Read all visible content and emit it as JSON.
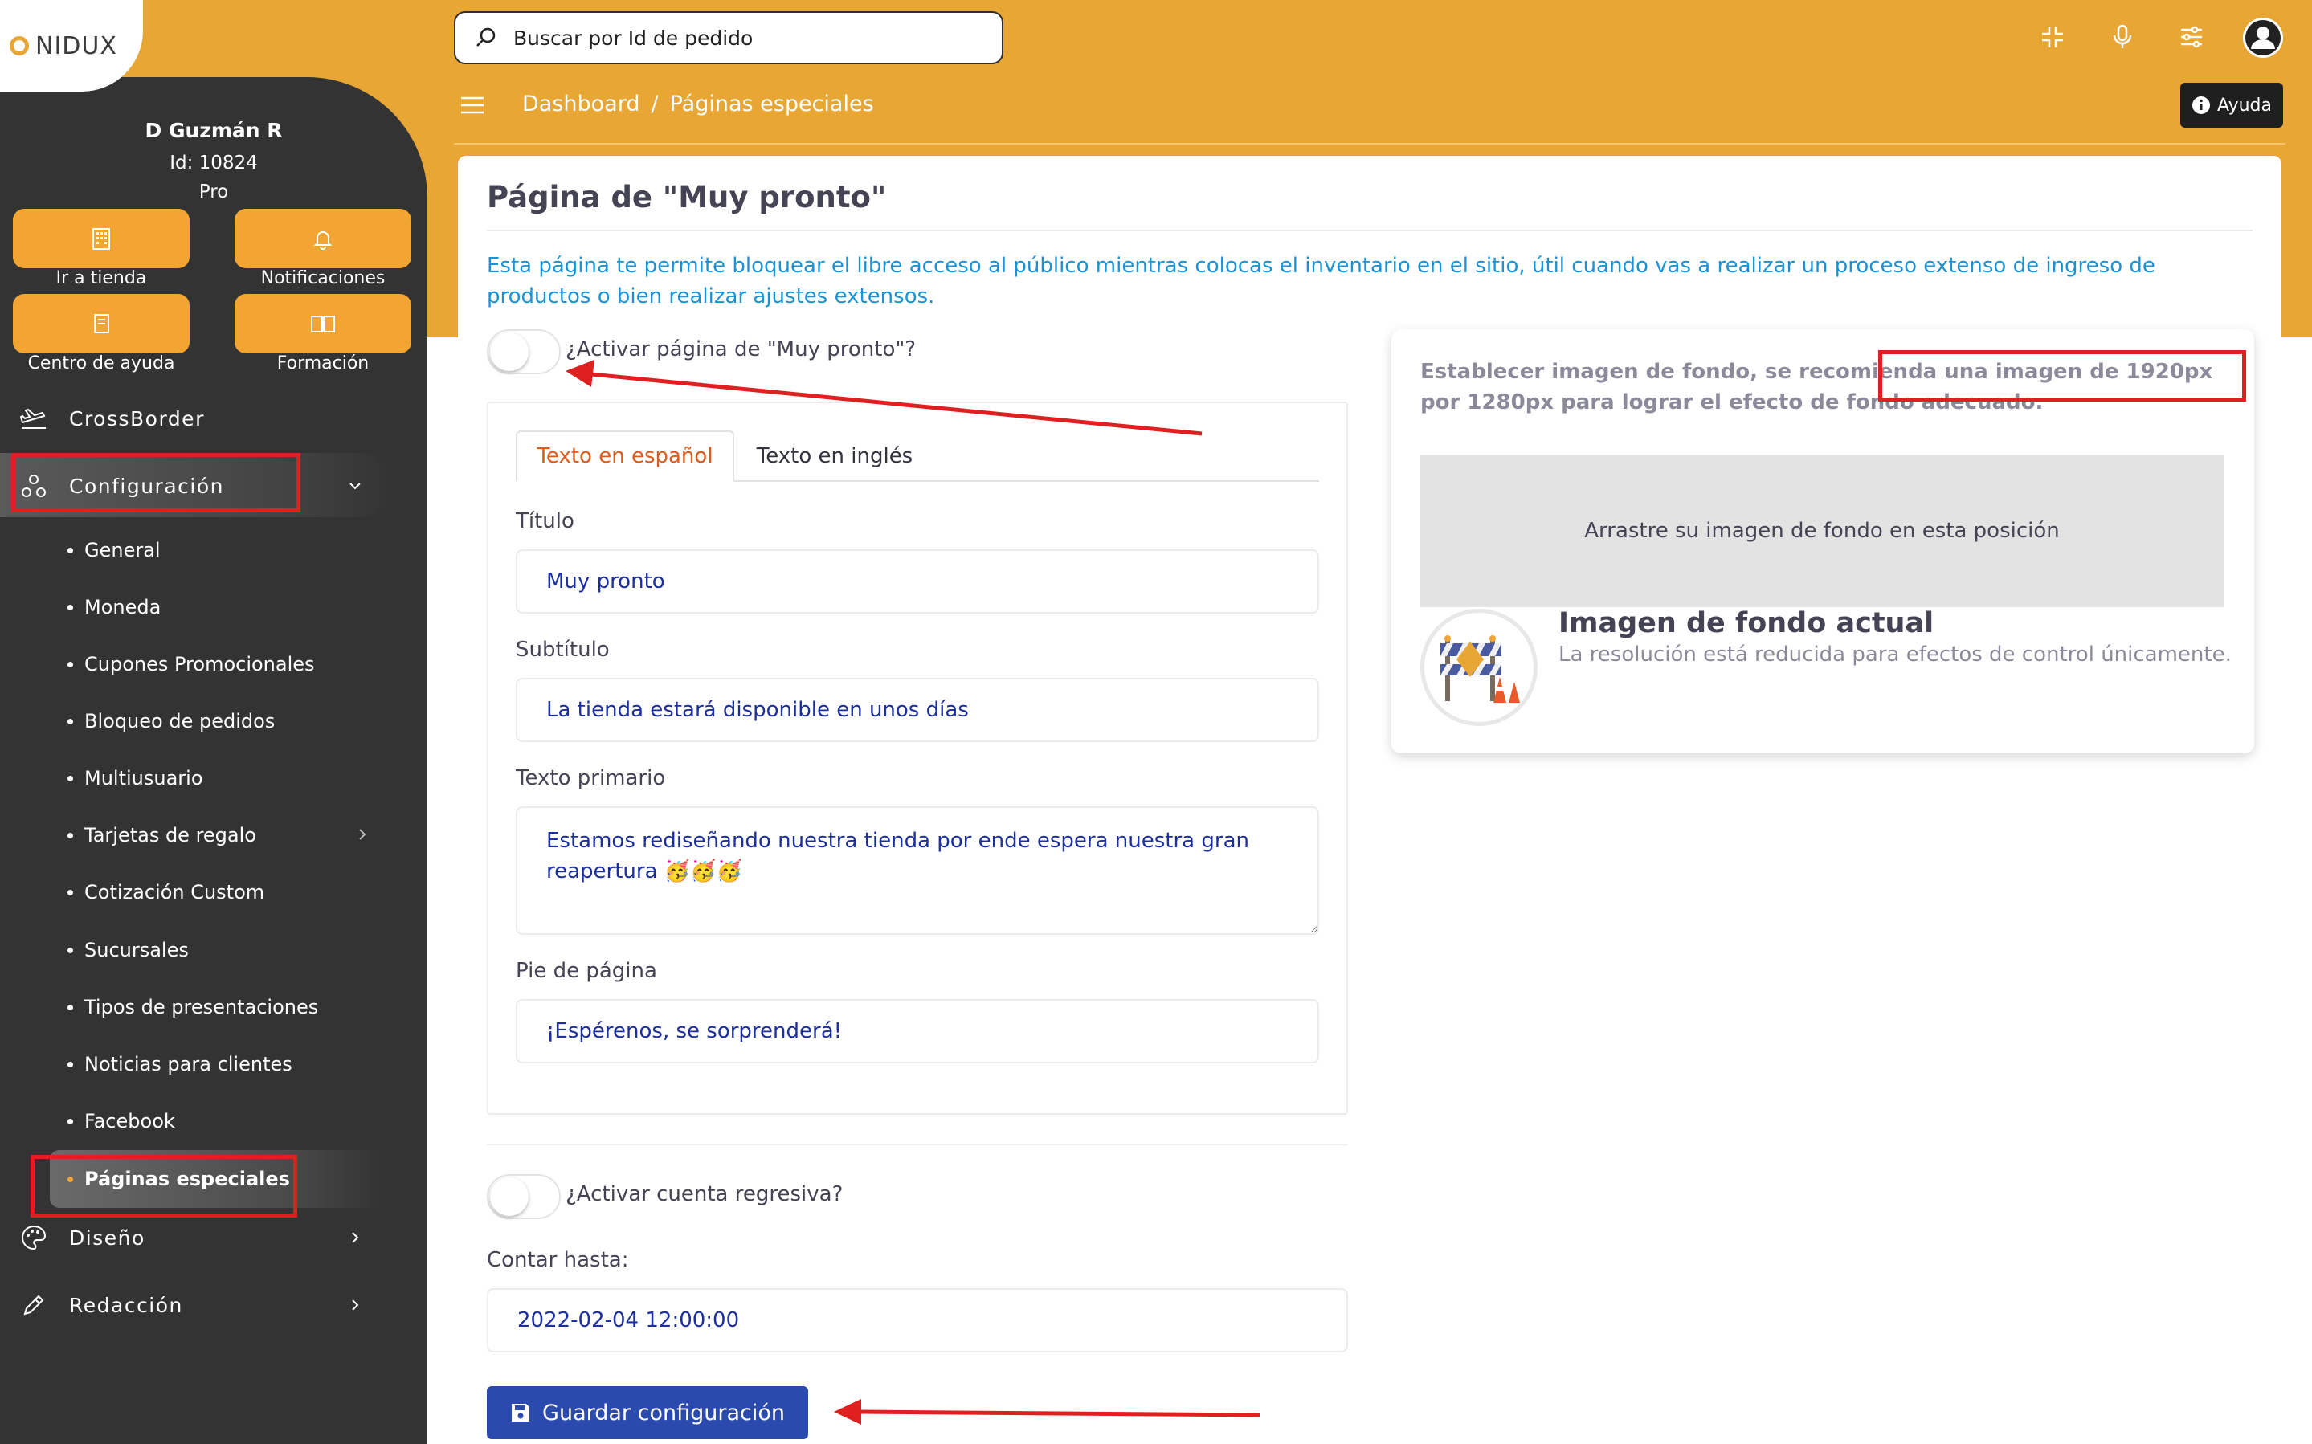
{
  "brand": {
    "name": "NIDUX"
  },
  "user": {
    "name": "D Guzmán R",
    "id_line": "Id: 10824",
    "plan": "Pro"
  },
  "quick_actions": [
    {
      "label": "Ir a tienda",
      "icon": "building-icon"
    },
    {
      "label": "Notificaciones",
      "icon": "bell-icon"
    },
    {
      "label": "Centro de ayuda",
      "icon": "book-icon"
    },
    {
      "label": "Formación",
      "icon": "open-book-icon"
    }
  ],
  "nav": {
    "crossborder": "CrossBorder",
    "configuracion": "Configuración",
    "diseno": "Diseño",
    "redaccion": "Redacción",
    "config_items": [
      "General",
      "Moneda",
      "Cupones Promocionales",
      "Bloqueo de pedidos",
      "Multiusuario",
      "Tarjetas de regalo",
      "Cotización Custom",
      "Sucursales",
      "Tipos de presentaciones",
      "Noticias para clientes",
      "Facebook",
      "Páginas especiales"
    ]
  },
  "header": {
    "search_placeholder": "Buscar por Id de pedido",
    "breadcrumb": {
      "home": "Dashboard",
      "separator": "/",
      "current": "Páginas especiales"
    },
    "help_label": "Ayuda"
  },
  "page": {
    "title": "Página de \"Muy pronto\"",
    "description": "Esta página te permite bloquear el libre acceso al público mientras colocas el inventario en el sitio, útil cuando vas a realizar un proceso extenso de ingreso de productos o bien realizar ajustes extensos.",
    "toggle_activate_label": "¿Activar página de \"Muy pronto\"?",
    "tabs": {
      "spanish": "Texto en español",
      "english": "Texto en inglés"
    },
    "fields": {
      "title_label": "Título",
      "title_value": "Muy pronto",
      "subtitle_label": "Subtítulo",
      "subtitle_value": "La tienda estará disponible en unos días",
      "primary_label": "Texto primario",
      "primary_value": "Estamos rediseñando nuestra tienda por ende espera nuestra gran reapertura 🥳🥳🥳",
      "footer_label": "Pie de página",
      "footer_value": "¡Espérenos, se sorprenderá!"
    },
    "toggle_countdown_label": "¿Activar cuenta regresiva?",
    "countdown_label": "Contar hasta:",
    "countdown_value": "2022-02-04 12:00:00",
    "save_label": "Guardar configuración"
  },
  "background": {
    "hint_prefix": "Establecer imagen de fondo, se recomienda ",
    "hint_highlight": "una imagen de 1920px por 1280px",
    "hint_suffix": " para lograr el efecto de fondo adecuado.",
    "dropzone_text": "Arrastre su imagen de fondo en esta posición",
    "current_title": "Imagen de fondo actual",
    "current_desc": "La resolución está reducida para efectos de control únicamente."
  },
  "colors": {
    "header_orange": "#e8a634",
    "button_orange": "#f2a532",
    "sidebar_dark": "#333333",
    "primary_blue": "#2b4aad",
    "info_blue": "#1a93d6",
    "tab_active": "#e05a1c",
    "annotation_red": "#e02020"
  }
}
